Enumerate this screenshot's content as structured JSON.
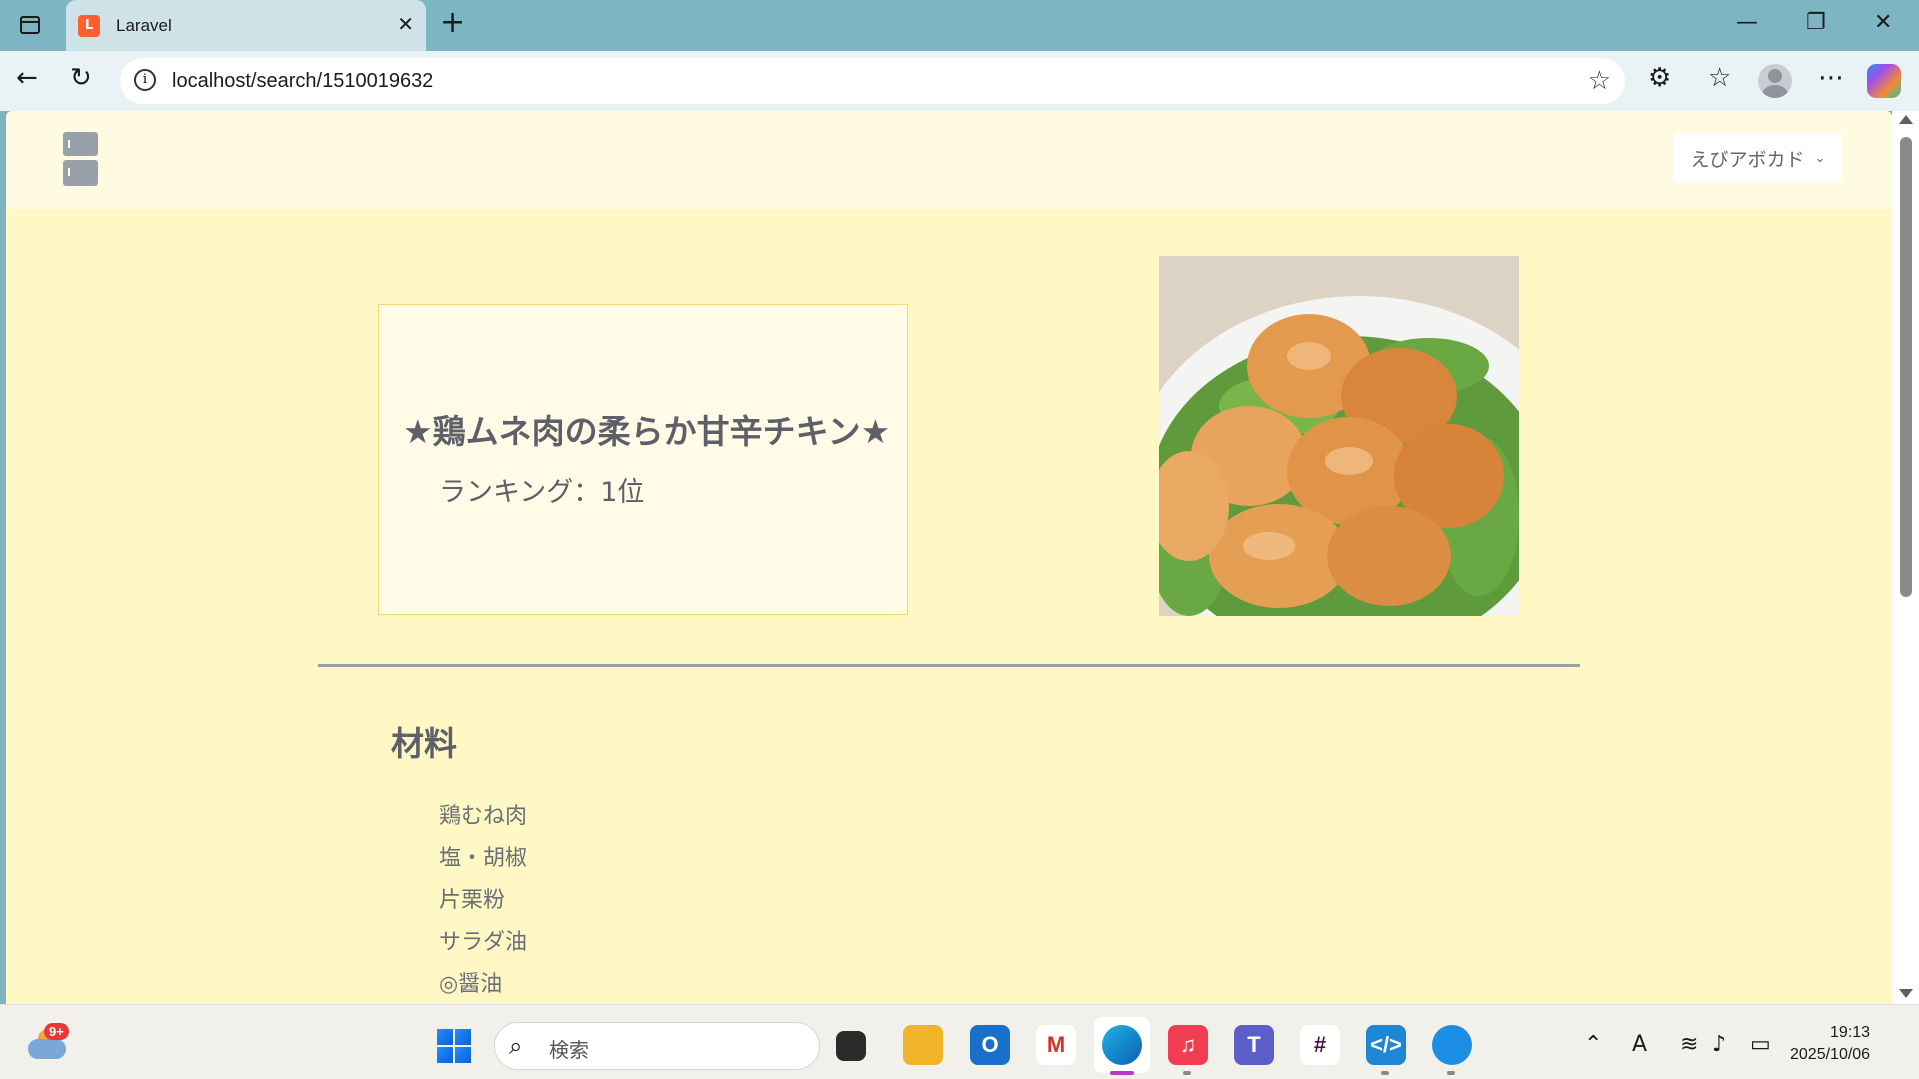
{
  "browser": {
    "tab_title": "Laravel",
    "url": "localhost/search/1510019632",
    "favicon_text": "L"
  },
  "app": {
    "user_name": "えびアボカド"
  },
  "recipe": {
    "title": "★鶏ムネ肉の柔らか甘辛チキン★",
    "ranking": "ランキング：1位",
    "ingredients_heading": "材料",
    "ingredients": [
      "鶏むね肉",
      "塩・胡椒",
      "片栗粉",
      "サラダ油",
      "◎醤油"
    ]
  },
  "taskbar": {
    "weather_badge": "9+",
    "search_placeholder": "検索",
    "time": "19:13",
    "date": "2025/10/06"
  },
  "colors": {
    "page_bg": "#fff8c5",
    "header_bg": "#fffbe3",
    "card_border": "#f1d97a",
    "text": "#5e6069"
  }
}
